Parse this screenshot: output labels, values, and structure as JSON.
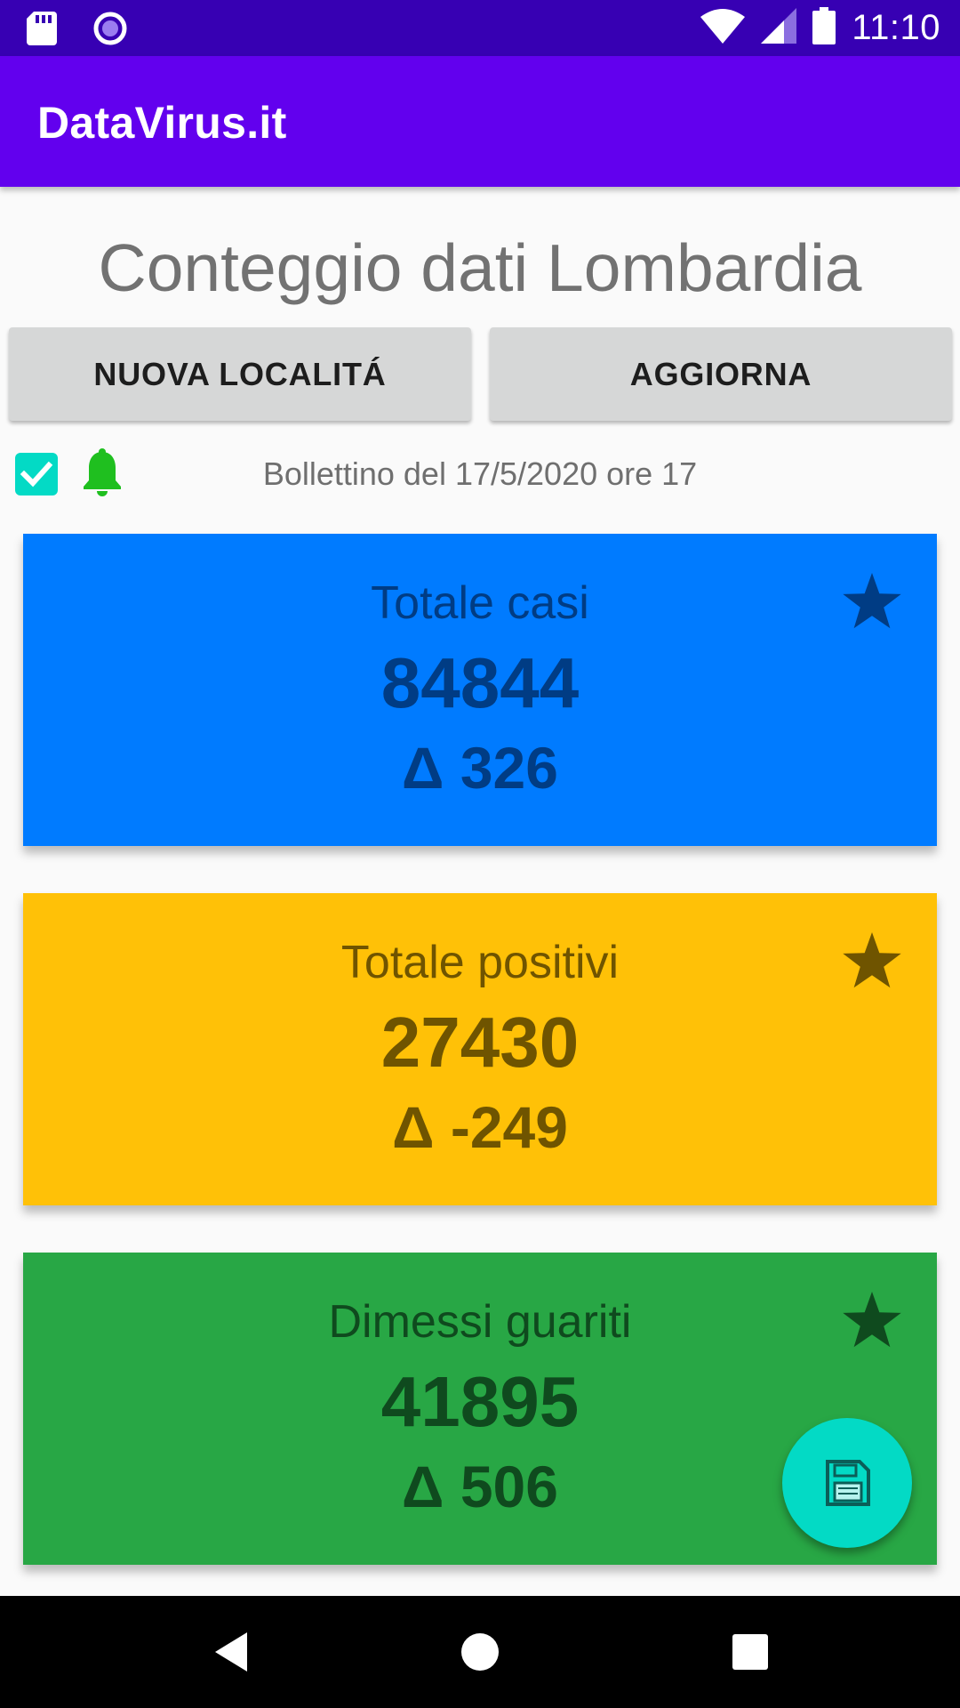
{
  "status_bar": {
    "time": "11:10",
    "icons": [
      "sd-card-icon",
      "media-circle-icon",
      "wifi-icon",
      "signal-icon",
      "battery-icon"
    ]
  },
  "app_bar": {
    "title": "DataVirus.it"
  },
  "page": {
    "title": "Conteggio dati Lombardia"
  },
  "buttons": {
    "new_location": "NUOVA LOCALITÁ",
    "refresh": "AGGIORNA"
  },
  "notifications": {
    "checked": true,
    "icon": "bell-icon"
  },
  "bulletin": "Bollettino del 17/5/2020 ore 17",
  "cards": [
    {
      "title": "Totale casi",
      "value": "84844",
      "delta": "Δ 326",
      "background": "#007bff",
      "foreground": "#003c84",
      "icon": "star-icon"
    },
    {
      "title": "Totale positivi",
      "value": "27430",
      "delta": "Δ -249",
      "background": "#ffc107",
      "foreground": "#6f5400",
      "icon": "star-icon"
    },
    {
      "title": "Dimessi guariti",
      "value": "41895",
      "delta": "Δ 506",
      "background": "#28a745",
      "foreground": "#0f4a1e",
      "icon": "star-icon"
    }
  ],
  "fab": {
    "icon": "save-icon",
    "color": "#03dac5"
  },
  "colors": {
    "status_bar": "#3700b3",
    "app_bar": "#6200ee",
    "accent": "#03dac5",
    "bell": "#1fbf1f"
  },
  "nav_bar": {
    "icons": [
      "back-icon",
      "home-icon",
      "recents-icon"
    ]
  }
}
